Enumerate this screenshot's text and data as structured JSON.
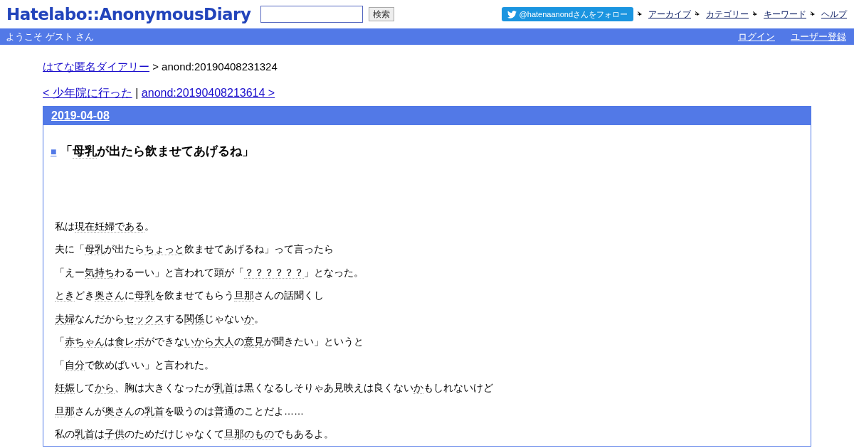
{
  "header": {
    "logo": "Hatelabo::AnonymousDiary",
    "search": {
      "button": "検索"
    },
    "follow_button": "@hatenaanondさんをフォロー",
    "nav_links": [
      "アーカイブ",
      "カテゴリー",
      "キーワード",
      "ヘルプ"
    ]
  },
  "user_bar": {
    "welcome": "ようこそ ゲスト さん",
    "links": [
      "ログイン",
      "ユーザー登録"
    ]
  },
  "breadcrumb": {
    "link": "はてな匿名ダイアリー",
    "current": "> anond:20190408231324"
  },
  "pager": {
    "prev": "< 少年院に行った",
    "separator": "|",
    "next": "anond:20190408213614 >"
  },
  "entry": {
    "date": "2019-04-08",
    "bullet": "■",
    "title": [
      {
        "text": "「",
        "keyword": false
      },
      {
        "text": "母乳",
        "keyword": true
      },
      {
        "text": "が出たら飲ませてあげるね」",
        "keyword": false
      }
    ],
    "paragraphs": [
      [
        {
          "text": "私は",
          "keyword": false
        },
        {
          "text": "現在",
          "keyword": true
        },
        {
          "text": "妊婦である",
          "keyword": true
        },
        {
          "text": "。",
          "keyword": false
        }
      ],
      [
        {
          "text": "夫に「",
          "keyword": false
        },
        {
          "text": "母乳",
          "keyword": true
        },
        {
          "text": "が出たら",
          "keyword": false
        },
        {
          "text": "ちょっと",
          "keyword": true
        },
        {
          "text": "飲ませてあげるね」って言ったら",
          "keyword": false
        }
      ],
      [
        {
          "text": "「えー",
          "keyword": false
        },
        {
          "text": "気持ち",
          "keyword": true
        },
        {
          "text": "わるーい」と言われて頭が「",
          "keyword": false
        },
        {
          "text": "？？？？？？",
          "keyword": true
        },
        {
          "text": "」となった。",
          "keyword": false
        }
      ],
      [
        {
          "text": "とき",
          "keyword": true
        },
        {
          "text": "どき",
          "keyword": false
        },
        {
          "text": "奥さん",
          "keyword": true
        },
        {
          "text": "に",
          "keyword": false
        },
        {
          "text": "母乳",
          "keyword": true
        },
        {
          "text": "を飲ませてもらう",
          "keyword": false
        },
        {
          "text": "旦那",
          "keyword": true
        },
        {
          "text": "さんの話聞くし",
          "keyword": false
        }
      ],
      [
        {
          "text": "夫婦",
          "keyword": true
        },
        {
          "text": "なんだから",
          "keyword": false
        },
        {
          "text": "セックス",
          "keyword": true
        },
        {
          "text": "する",
          "keyword": false
        },
        {
          "text": "関係",
          "keyword": true
        },
        {
          "text": "じゃない",
          "keyword": false
        },
        {
          "text": "か",
          "keyword": true
        },
        {
          "text": "。",
          "keyword": false
        }
      ],
      [
        {
          "text": "「",
          "keyword": false
        },
        {
          "text": "赤ちゃん",
          "keyword": true
        },
        {
          "text": "は",
          "keyword": false
        },
        {
          "text": "食レポ",
          "keyword": true
        },
        {
          "text": "ができな",
          "keyword": false
        },
        {
          "text": "いから",
          "keyword": true
        },
        {
          "text": "大人",
          "keyword": true
        },
        {
          "text": "の",
          "keyword": false
        },
        {
          "text": "意見",
          "keyword": true
        },
        {
          "text": "が聞きたい」というと",
          "keyword": false
        }
      ],
      [
        {
          "text": "「",
          "keyword": false
        },
        {
          "text": "自分",
          "keyword": true
        },
        {
          "text": "で飲めばいい」と言われた。",
          "keyword": false
        }
      ],
      [
        {
          "text": "妊娠",
          "keyword": true
        },
        {
          "text": "して",
          "keyword": false
        },
        {
          "text": "から",
          "keyword": true
        },
        {
          "text": "、胸は大きくなったが",
          "keyword": false
        },
        {
          "text": "乳首",
          "keyword": true
        },
        {
          "text": "は黒くなるしそりゃあ見映えは良くない",
          "keyword": false
        },
        {
          "text": "か",
          "keyword": true
        },
        {
          "text": "もしれないけど",
          "keyword": false
        }
      ],
      [
        {
          "text": "旦那",
          "keyword": true
        },
        {
          "text": "さんが",
          "keyword": false
        },
        {
          "text": "奥さん",
          "keyword": true
        },
        {
          "text": "の",
          "keyword": false
        },
        {
          "text": "乳首",
          "keyword": true
        },
        {
          "text": "を吸うのは",
          "keyword": false
        },
        {
          "text": "普通",
          "keyword": true
        },
        {
          "text": "のことだよ……",
          "keyword": false
        }
      ],
      [
        {
          "text": "私の",
          "keyword": false
        },
        {
          "text": "乳首",
          "keyword": true
        },
        {
          "text": "は",
          "keyword": false
        },
        {
          "text": "子供",
          "keyword": true
        },
        {
          "text": "のためだけじゃなくて",
          "keyword": false
        },
        {
          "text": "旦那のもの",
          "keyword": true
        },
        {
          "text": "でもあるよ。",
          "keyword": false
        }
      ]
    ]
  }
}
